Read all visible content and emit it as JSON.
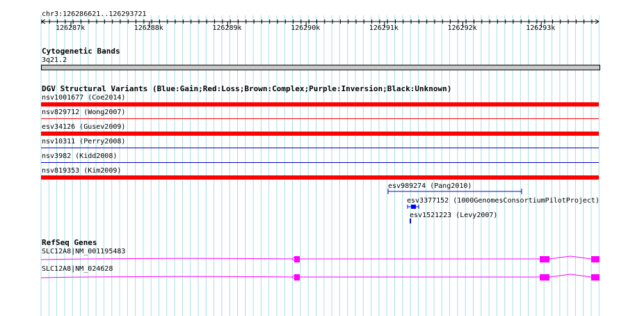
{
  "ruler": {
    "location": "chr3:126286621..126293721",
    "ticks": [
      "126287k",
      "126288k",
      "126289k",
      "126290k",
      "126291k",
      "126292k",
      "126293k"
    ]
  },
  "cytoband": {
    "title": "Cytogenetic Bands",
    "band": "3q21.2"
  },
  "dgv": {
    "title": "DGV Structural Variants (Blue:Gain;Red:Loss;Brown:Complex;Purple:Inversion;Black:Unknown)",
    "rows": [
      {
        "label": "nsv1001677 (Coe2014)",
        "color": "#ff0000"
      },
      {
        "label": "nsv829712 (Wong2007)",
        "color": "#ff0000"
      },
      {
        "label": "esv34126 (Gusev2009)",
        "color": "#ff0000"
      },
      {
        "label": "nsv10311 (Perry2008)",
        "color": "#0000cc"
      },
      {
        "label": "nsv3982 (Kidd2008)",
        "color": "#0000cc"
      },
      {
        "label": "nsv819353 (Kim2009)",
        "color": "#ff0000"
      }
    ],
    "short_items": [
      {
        "label": "esv989274 (Pang2010)",
        "color": "#0000cc"
      },
      {
        "label": "esv3377152 (1000GenomesConsortiumPilotProject)",
        "color": "#0000ff"
      },
      {
        "label": "esv1521223 (Levy2007)",
        "color": "#0000cc"
      }
    ]
  },
  "refseq": {
    "title": "RefSeq Genes",
    "genes": [
      {
        "label": "SLC12A8|NM_001195483"
      },
      {
        "label": "SLC12A8|NM_024628"
      }
    ],
    "color": "#ff00ff"
  }
}
